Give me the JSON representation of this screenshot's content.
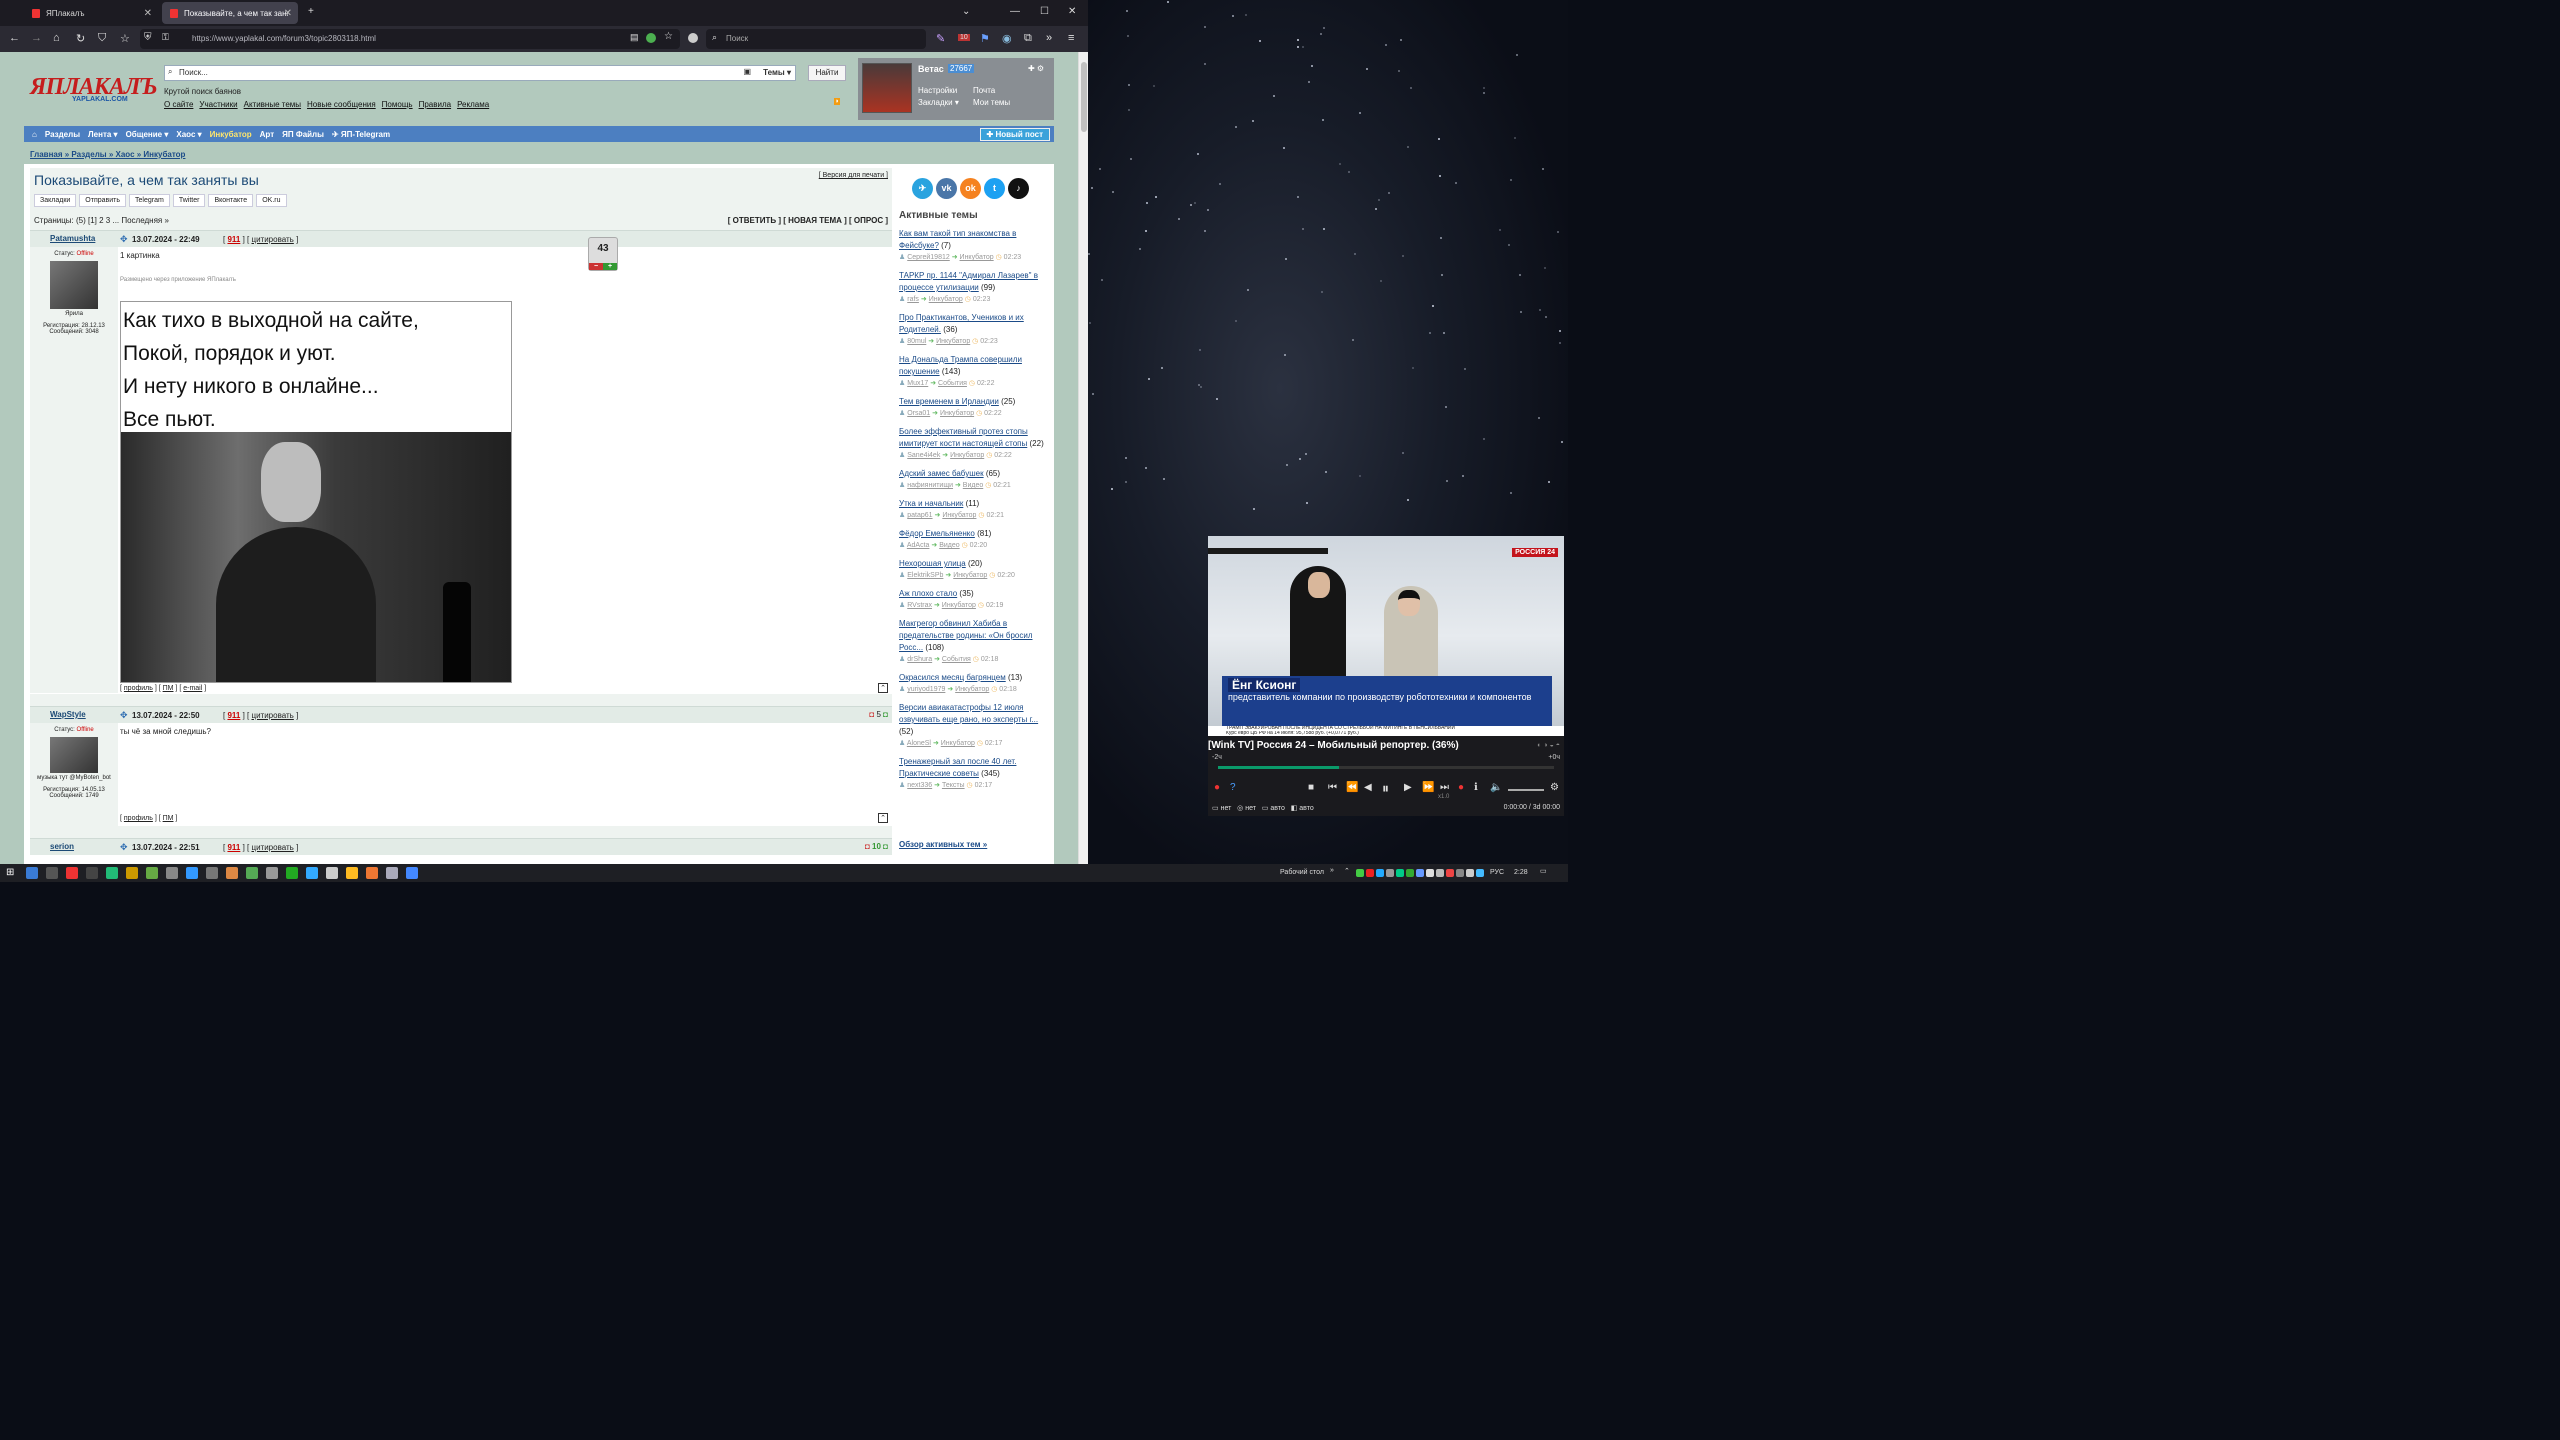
{
  "browser": {
    "tabs": [
      {
        "label": "ЯПлакалъ"
      },
      {
        "label": "Показывайте, а чем так заняты"
      }
    ],
    "url": "https://www.yaplakal.com/forum3/topic2803118.html",
    "search_placeholder": "Поиск",
    "badge_count": "10"
  },
  "site": {
    "logo": "ЯПЛАКАЛЪ",
    "logo_sub": "YAPLAKAL.COM",
    "search_placeholder": "Поиск...",
    "themes_label": "Темы",
    "find_button": "Найти",
    "tagline": "Крутой поиск баянов",
    "top_links": [
      "О сайте",
      "Участники",
      "Активные темы",
      "Новые сообщения",
      "Помощь",
      "Правила",
      "Реклама"
    ],
    "user": {
      "name": "Ветас",
      "rep": "27667",
      "links": [
        "Настройки",
        "Почта",
        "Закладки",
        "Мои темы"
      ]
    },
    "menu": [
      "Разделы",
      "Лента",
      "Общение",
      "Хаос",
      "Инкубатор",
      "Арт",
      "ЯП Файлы",
      "ЯП-Telegram"
    ],
    "new_post": "Новый пост",
    "breadcrumbs": "Главная » Разделы » Хаос » Инкубатор"
  },
  "topic": {
    "title": "Показывайте, а чем так заняты вы",
    "print_version": "[ Версия для печати ]",
    "share": [
      "Закладки",
      "Отправить",
      "Telegram",
      "Twitter",
      "Вконтакте",
      "OK.ru"
    ],
    "pages": "Страницы: (5) [1] 2 3 ... Последняя »",
    "actions": "[ ОТВЕТИТЬ ] [ НОВАЯ ТЕМА ] [ ОПРОС ]"
  },
  "posts": [
    {
      "author": "Patamushta",
      "date": "13.07.2024 - 22:49",
      "num": "911",
      "quote": "цитировать",
      "status_label": "Статус:",
      "status": "Offline",
      "caption": "Ярила",
      "reg": "Регистрация: 28.12.13",
      "msgs": "Сообщений: 3048",
      "text": "1 картинка",
      "via": "Размещено через приложение ЯПлакалъ",
      "rating": "43",
      "meme_lines": [
        "Как тихо в выходной на сайте,",
        "Покой, порядок и уют.",
        "И нету никого в онлайне...",
        "Все пьют."
      ],
      "foot": [
        "профиль",
        "ПМ",
        "e-mail"
      ]
    },
    {
      "author": "WapStyle",
      "date": "13.07.2024 - 22:50",
      "num": "911",
      "quote": "цитировать",
      "status_label": "Статус:",
      "status": "Offline",
      "caption": "музыка тут @MyBoten_bot",
      "reg": "Регистрация: 14.05.13",
      "msgs": "Сообщений: 1749",
      "text": "ты чё за мной следишь?",
      "rating": "5",
      "foot": [
        "профиль",
        "ПМ"
      ]
    },
    {
      "author": "serion",
      "date": "13.07.2024 - 22:51",
      "num": "911",
      "quote": "цитировать",
      "rating": "10"
    }
  ],
  "sidebar": {
    "title": "Активные темы",
    "topics": [
      {
        "title": "Как вам такой тип знакомства в Фейсбуке?",
        "count": "(7)",
        "user": "Сергей19812",
        "section": "Инкубатор",
        "time": "02:23"
      },
      {
        "title": "ТАРКР пр. 1144 \"Адмирал Лазарев\" в процессе утилизации",
        "count": "(99)",
        "user": "rafs",
        "section": "Инкубатор",
        "time": "02:23"
      },
      {
        "title": "Про Практикантов, Учеников и их Родителей.",
        "count": "(36)",
        "user": "80mul",
        "section": "Инкубатор",
        "time": "02:23"
      },
      {
        "title": "На Дональда Трампа совершили покушение",
        "count": "(143)",
        "user": "Mux17",
        "section": "События",
        "time": "02:22"
      },
      {
        "title": "Тем временем в Ирландии",
        "count": "(25)",
        "user": "Orsa01",
        "section": "Инкубатор",
        "time": "02:22"
      },
      {
        "title": "Более эффективный протез стопы имитирует кости настоящей стопы",
        "count": "(22)",
        "user": "Sane4i4ek",
        "section": "Инкубатор",
        "time": "02:22"
      },
      {
        "title": "Адский замес бабушек",
        "count": "(65)",
        "user": "нафиянитищи",
        "section": "Видео",
        "time": "02:21"
      },
      {
        "title": "Утка и начальник",
        "count": "(11)",
        "user": "patap61",
        "section": "Инкубатор",
        "time": "02:21"
      },
      {
        "title": "Фёдор Емельяненко",
        "count": "(81)",
        "user": "AdActa",
        "section": "Видео",
        "time": "02:20"
      },
      {
        "title": "Нехорошая улица",
        "count": "(20)",
        "user": "ElektrikSPb",
        "section": "Инкубатор",
        "time": "02:20"
      },
      {
        "title": "Аж плохо стало",
        "count": "(35)",
        "user": "RVstrax",
        "section": "Инкубатор",
        "time": "02:19"
      },
      {
        "title": "Макгрегор обвинил Хабиба в предательстве родины: «Он бросил Росс...",
        "count": "(108)",
        "user": "drShura",
        "section": "События",
        "time": "02:18"
      },
      {
        "title": "Окрасился месяц багрянцем",
        "count": "(13)",
        "user": "yuriyod1979",
        "section": "Инкубатор",
        "time": "02:18"
      },
      {
        "title": "Версии авиакатастрофы 12 июля озвучивать еще рано, но эксперты г...",
        "count": "(52)",
        "user": "AloneSl",
        "section": "Инкубатор",
        "time": "02:17"
      },
      {
        "title": "Тренажерный зал после 40 лет. Практические советы",
        "count": "(345)",
        "user": "next336",
        "section": "Тексты",
        "time": "02:17"
      }
    ],
    "all_active": "Обзор активных тем »"
  },
  "player": {
    "title": "[Wink TV] Россия 24 – Мобильный репортер. (36%)",
    "progress": 0.36,
    "time_left": "-2ч",
    "time_right": "+0ч",
    "channel_badge": "РОССИЯ 24",
    "lower_name": "Ёнг Ксионг",
    "lower_desc": "представитель компании по производству робототехники и компонентов",
    "ticker": "ТРАМП ЭВАКУИРОВАН ПОСЛЕ ИНЦИДЕНТА СО СТРЕЛЬБОЙ НА МИТИНГЕ В ПЕНСИЛЬВАНИИ",
    "ticker2": "Курс евро ЦБ РФ на 14 июля: 95,7588 руб. (+0,0771 руб.)",
    "bottom_left": "нет",
    "bottom_mid": "нет",
    "bottom_auto": "авто",
    "bottom_auto2": "авто",
    "elapsed": "0:00:00 / 3d 00:00",
    "speed": "x1.0"
  },
  "taskbar": {
    "desktop_label": "Рабочий стол",
    "lang": "РУС",
    "clock": "2:28"
  },
  "colors": {
    "page_bg": "#b2c9bd",
    "menu": "#4c7fc1",
    "link": "#1b4b88",
    "offline": "#cc0000"
  }
}
